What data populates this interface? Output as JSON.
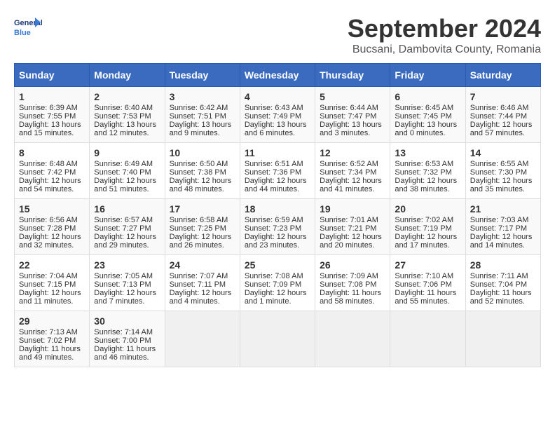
{
  "logo": {
    "line1": "General",
    "line2": "Blue"
  },
  "title": "September 2024",
  "location": "Bucsani, Dambovita County, Romania",
  "headers": [
    "Sunday",
    "Monday",
    "Tuesday",
    "Wednesday",
    "Thursday",
    "Friday",
    "Saturday"
  ],
  "weeks": [
    [
      {
        "day": "1",
        "sunrise": "Sunrise: 6:39 AM",
        "sunset": "Sunset: 7:55 PM",
        "daylight": "Daylight: 13 hours and 15 minutes."
      },
      {
        "day": "2",
        "sunrise": "Sunrise: 6:40 AM",
        "sunset": "Sunset: 7:53 PM",
        "daylight": "Daylight: 13 hours and 12 minutes."
      },
      {
        "day": "3",
        "sunrise": "Sunrise: 6:42 AM",
        "sunset": "Sunset: 7:51 PM",
        "daylight": "Daylight: 13 hours and 9 minutes."
      },
      {
        "day": "4",
        "sunrise": "Sunrise: 6:43 AM",
        "sunset": "Sunset: 7:49 PM",
        "daylight": "Daylight: 13 hours and 6 minutes."
      },
      {
        "day": "5",
        "sunrise": "Sunrise: 6:44 AM",
        "sunset": "Sunset: 7:47 PM",
        "daylight": "Daylight: 13 hours and 3 minutes."
      },
      {
        "day": "6",
        "sunrise": "Sunrise: 6:45 AM",
        "sunset": "Sunset: 7:45 PM",
        "daylight": "Daylight: 13 hours and 0 minutes."
      },
      {
        "day": "7",
        "sunrise": "Sunrise: 6:46 AM",
        "sunset": "Sunset: 7:44 PM",
        "daylight": "Daylight: 12 hours and 57 minutes."
      }
    ],
    [
      {
        "day": "8",
        "sunrise": "Sunrise: 6:48 AM",
        "sunset": "Sunset: 7:42 PM",
        "daylight": "Daylight: 12 hours and 54 minutes."
      },
      {
        "day": "9",
        "sunrise": "Sunrise: 6:49 AM",
        "sunset": "Sunset: 7:40 PM",
        "daylight": "Daylight: 12 hours and 51 minutes."
      },
      {
        "day": "10",
        "sunrise": "Sunrise: 6:50 AM",
        "sunset": "Sunset: 7:38 PM",
        "daylight": "Daylight: 12 hours and 48 minutes."
      },
      {
        "day": "11",
        "sunrise": "Sunrise: 6:51 AM",
        "sunset": "Sunset: 7:36 PM",
        "daylight": "Daylight: 12 hours and 44 minutes."
      },
      {
        "day": "12",
        "sunrise": "Sunrise: 6:52 AM",
        "sunset": "Sunset: 7:34 PM",
        "daylight": "Daylight: 12 hours and 41 minutes."
      },
      {
        "day": "13",
        "sunrise": "Sunrise: 6:53 AM",
        "sunset": "Sunset: 7:32 PM",
        "daylight": "Daylight: 12 hours and 38 minutes."
      },
      {
        "day": "14",
        "sunrise": "Sunrise: 6:55 AM",
        "sunset": "Sunset: 7:30 PM",
        "daylight": "Daylight: 12 hours and 35 minutes."
      }
    ],
    [
      {
        "day": "15",
        "sunrise": "Sunrise: 6:56 AM",
        "sunset": "Sunset: 7:28 PM",
        "daylight": "Daylight: 12 hours and 32 minutes."
      },
      {
        "day": "16",
        "sunrise": "Sunrise: 6:57 AM",
        "sunset": "Sunset: 7:27 PM",
        "daylight": "Daylight: 12 hours and 29 minutes."
      },
      {
        "day": "17",
        "sunrise": "Sunrise: 6:58 AM",
        "sunset": "Sunset: 7:25 PM",
        "daylight": "Daylight: 12 hours and 26 minutes."
      },
      {
        "day": "18",
        "sunrise": "Sunrise: 6:59 AM",
        "sunset": "Sunset: 7:23 PM",
        "daylight": "Daylight: 12 hours and 23 minutes."
      },
      {
        "day": "19",
        "sunrise": "Sunrise: 7:01 AM",
        "sunset": "Sunset: 7:21 PM",
        "daylight": "Daylight: 12 hours and 20 minutes."
      },
      {
        "day": "20",
        "sunrise": "Sunrise: 7:02 AM",
        "sunset": "Sunset: 7:19 PM",
        "daylight": "Daylight: 12 hours and 17 minutes."
      },
      {
        "day": "21",
        "sunrise": "Sunrise: 7:03 AM",
        "sunset": "Sunset: 7:17 PM",
        "daylight": "Daylight: 12 hours and 14 minutes."
      }
    ],
    [
      {
        "day": "22",
        "sunrise": "Sunrise: 7:04 AM",
        "sunset": "Sunset: 7:15 PM",
        "daylight": "Daylight: 12 hours and 11 minutes."
      },
      {
        "day": "23",
        "sunrise": "Sunrise: 7:05 AM",
        "sunset": "Sunset: 7:13 PM",
        "daylight": "Daylight: 12 hours and 7 minutes."
      },
      {
        "day": "24",
        "sunrise": "Sunrise: 7:07 AM",
        "sunset": "Sunset: 7:11 PM",
        "daylight": "Daylight: 12 hours and 4 minutes."
      },
      {
        "day": "25",
        "sunrise": "Sunrise: 7:08 AM",
        "sunset": "Sunset: 7:09 PM",
        "daylight": "Daylight: 12 hours and 1 minute."
      },
      {
        "day": "26",
        "sunrise": "Sunrise: 7:09 AM",
        "sunset": "Sunset: 7:08 PM",
        "daylight": "Daylight: 11 hours and 58 minutes."
      },
      {
        "day": "27",
        "sunrise": "Sunrise: 7:10 AM",
        "sunset": "Sunset: 7:06 PM",
        "daylight": "Daylight: 11 hours and 55 minutes."
      },
      {
        "day": "28",
        "sunrise": "Sunrise: 7:11 AM",
        "sunset": "Sunset: 7:04 PM",
        "daylight": "Daylight: 11 hours and 52 minutes."
      }
    ],
    [
      {
        "day": "29",
        "sunrise": "Sunrise: 7:13 AM",
        "sunset": "Sunset: 7:02 PM",
        "daylight": "Daylight: 11 hours and 49 minutes."
      },
      {
        "day": "30",
        "sunrise": "Sunrise: 7:14 AM",
        "sunset": "Sunset: 7:00 PM",
        "daylight": "Daylight: 11 hours and 46 minutes."
      },
      null,
      null,
      null,
      null,
      null
    ]
  ]
}
